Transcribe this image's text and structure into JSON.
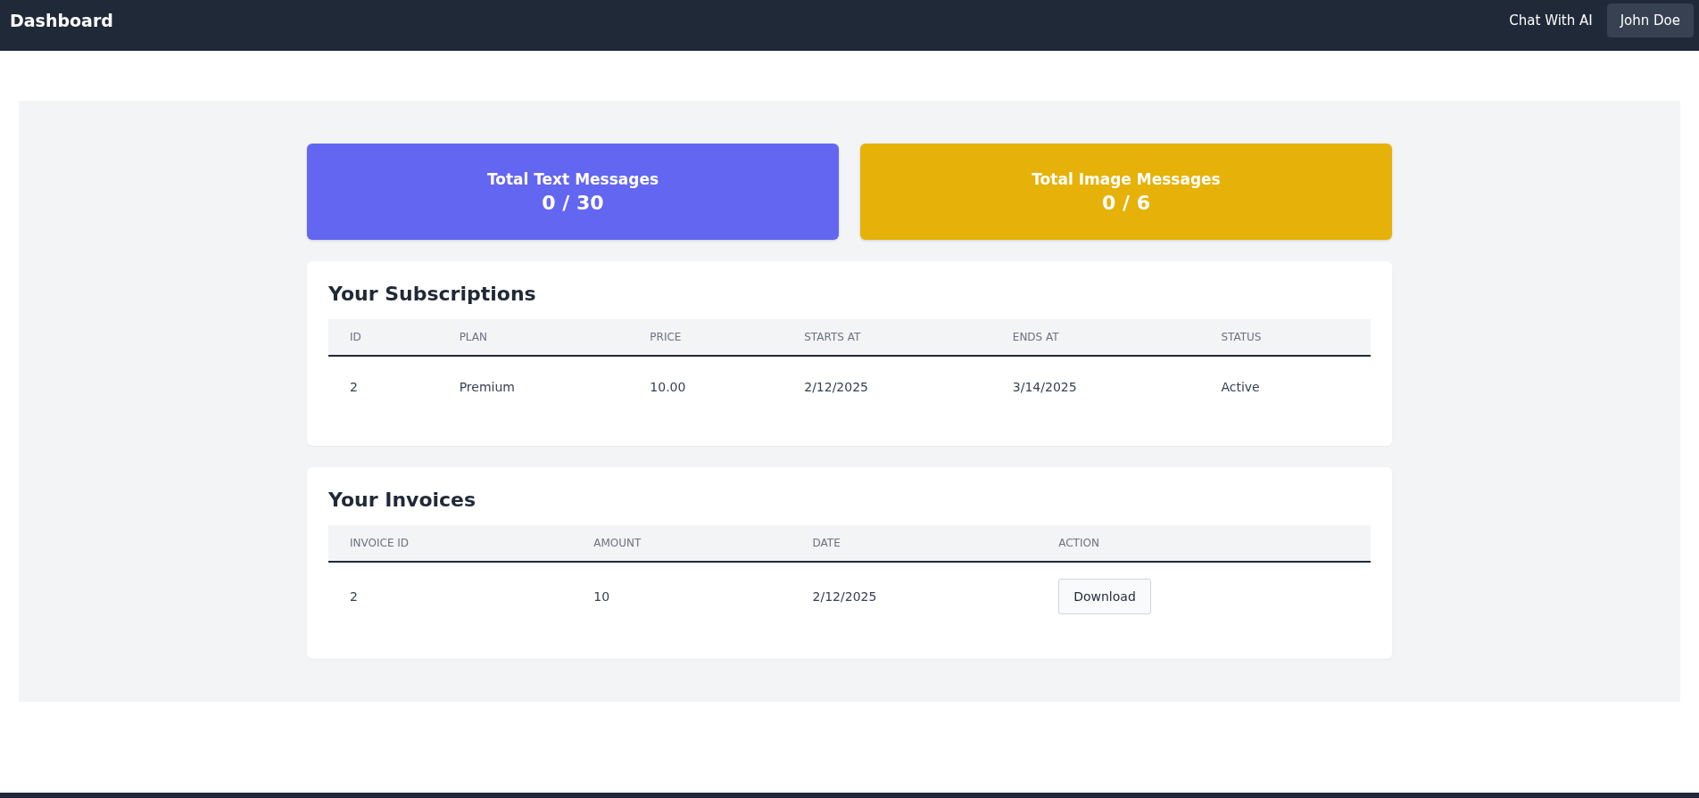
{
  "navbar": {
    "title": "Dashboard",
    "links": [
      {
        "label": "Chat With AI",
        "kind": "link"
      },
      {
        "label": "John Doe",
        "kind": "button"
      }
    ]
  },
  "stats": [
    {
      "label": "Total Text Messages",
      "value": "0 / 30",
      "color": "#6366f1"
    },
    {
      "label": "Total Image Messages",
      "value": "0 / 6",
      "color": "#e6b20a"
    }
  ],
  "subscriptions": {
    "title": "Your Subscriptions",
    "columns": [
      "ID",
      "PLAN",
      "PRICE",
      "STARTS AT",
      "ENDS AT",
      "STATUS"
    ],
    "rows": [
      [
        {
          "kind": "text",
          "text": "2"
        },
        {
          "kind": "text",
          "text": "Premium"
        },
        {
          "kind": "text",
          "text": "10.00"
        },
        {
          "kind": "text",
          "text": "2/12/2025"
        },
        {
          "kind": "text",
          "text": "3/14/2025"
        },
        {
          "kind": "text",
          "text": "Active"
        }
      ]
    ]
  },
  "invoices": {
    "title": "Your Invoices",
    "columns": [
      "INVOICE ID",
      "AMOUNT",
      "DATE",
      "ACTION"
    ],
    "rows": [
      [
        {
          "kind": "text",
          "text": "2"
        },
        {
          "kind": "text",
          "text": "10"
        },
        {
          "kind": "text",
          "text": "2/12/2025"
        },
        {
          "kind": "button",
          "text": "Download"
        }
      ]
    ]
  }
}
